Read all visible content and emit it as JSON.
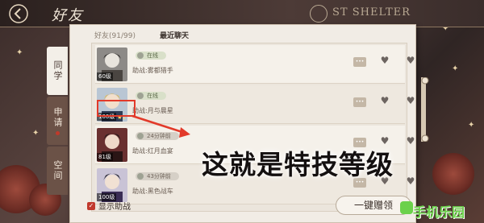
{
  "header": {
    "title": "好友",
    "brand": "ST SHELTER"
  },
  "side_tabs": [
    {
      "label": "同学",
      "active": true
    },
    {
      "label": "申请",
      "active": false,
      "badge": true
    },
    {
      "label": "空间",
      "active": false
    }
  ],
  "panel_tabs": [
    {
      "label": "好友(91/99)",
      "active": false
    },
    {
      "label": "最近聊天",
      "active": true
    }
  ],
  "friends": [
    {
      "level": "60级",
      "stars": "",
      "status": "在线",
      "assist": "助战:雾都猎手"
    },
    {
      "level": "100级",
      "stars": "★1",
      "status": "在线",
      "assist": "助战:月与晨星"
    },
    {
      "level": "81级",
      "stars": "",
      "status": "24分钟前",
      "assist": "助战:红月血宴"
    },
    {
      "level": "100级",
      "stars": "",
      "status": "43分钟前",
      "assist": "助战:黑色战车"
    }
  ],
  "annotation": "这就是特技等级",
  "footer": {
    "show_assist_label": "显示助战",
    "gift_button": "一键赠领"
  },
  "watermark": "手机乐园",
  "colors": {
    "accent_red": "#c1392d",
    "highlight_box": "#e23a2a",
    "watermark_green": "#6bd14b"
  }
}
